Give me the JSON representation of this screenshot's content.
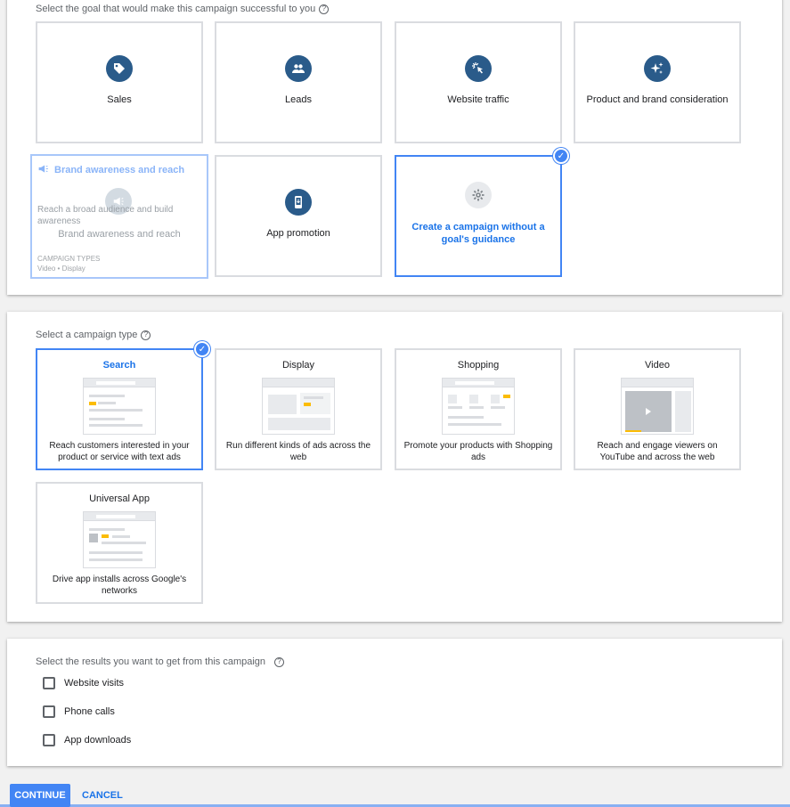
{
  "goal_section": {
    "label": "Select the goal that would make this campaign successful to you",
    "goals": [
      {
        "label": "Sales",
        "icon": "tag-icon"
      },
      {
        "label": "Leads",
        "icon": "people-icon"
      },
      {
        "label": "Website traffic",
        "icon": "cursor-click-icon"
      },
      {
        "label": "Product and brand consideration",
        "icon": "sparkle-icon"
      },
      {
        "label": "Brand awareness and reach",
        "icon": "megaphone-icon",
        "hover_title": "Brand awareness and reach",
        "hover_desc": "Reach a broad audience and build awareness",
        "types_heading": "CAMPAIGN TYPES",
        "types_list": "Video • Display"
      },
      {
        "label": "App promotion",
        "icon": "phone-icon"
      },
      {
        "label": "Create a campaign without a goal's guidance",
        "icon": "gear-icon",
        "selected": true
      }
    ]
  },
  "type_section": {
    "label": "Select a campaign type",
    "types": [
      {
        "title": "Search",
        "desc": "Reach customers interested in your product or service with text ads",
        "selected": true
      },
      {
        "title": "Display",
        "desc": "Run different kinds of ads across the web"
      },
      {
        "title": "Shopping",
        "desc": "Promote your products with Shopping ads"
      },
      {
        "title": "Video",
        "desc": "Reach and engage viewers on YouTube and across the web"
      },
      {
        "title": "Universal App",
        "desc": "Drive app installs across Google's networks"
      }
    ]
  },
  "results_section": {
    "label": "Select the results you want to get from this campaign",
    "options": [
      {
        "label": "Website visits",
        "checked": false
      },
      {
        "label": "Phone calls",
        "checked": false
      },
      {
        "label": "App downloads",
        "checked": false
      }
    ]
  },
  "actions": {
    "continue_label": "CONTINUE",
    "cancel_label": "CANCEL"
  },
  "colors": {
    "accent": "#4285f4",
    "icon_bg": "#2a5b8a",
    "highlight": "#fbbc04"
  }
}
